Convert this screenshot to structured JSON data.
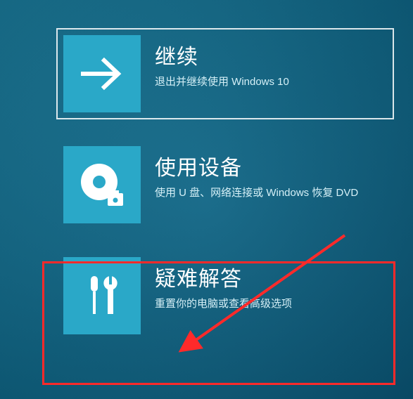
{
  "options": [
    {
      "id": "continue",
      "title": "继续",
      "desc": "退出并继续使用 Windows 10",
      "icon": "arrow-right",
      "selected": true
    },
    {
      "id": "use-device",
      "title": "使用设备",
      "desc": "使用 U 盘、网络连接或 Windows 恢复 DVD",
      "icon": "disc-device",
      "selected": false
    },
    {
      "id": "troubleshoot",
      "title": "疑难解答",
      "desc": "重置你的电脑或查看高级选项",
      "icon": "tools",
      "selected": false
    }
  ],
  "annotation": {
    "highlight_option": "troubleshoot",
    "box_color": "#ff2a2a"
  }
}
